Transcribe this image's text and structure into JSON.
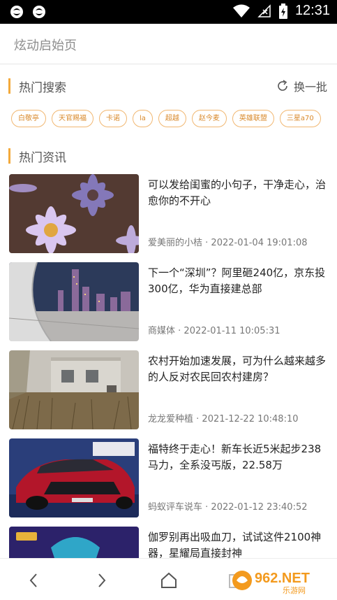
{
  "status_bar": {
    "time": "12:31"
  },
  "header": {
    "title": "炫动启始页"
  },
  "hot_search": {
    "title": "热门搜索",
    "refresh_label": "换一批",
    "tags": [
      "白敬亭",
      "天官赐福",
      "卡诺",
      "la",
      "超越",
      "赵今麦",
      "英雄联盟",
      "三星a70"
    ]
  },
  "hot_news": {
    "title": "热门资讯",
    "items": [
      {
        "title": "可以发给闺蜜的小句子，干净走心，治愈你的不开心",
        "source": "爱美丽的小桔",
        "time": "2022-01-04 19:01:08"
      },
      {
        "title": "下一个“深圳”？阿里砸240亿，京东投300亿，华为直接建总部",
        "source": "商媒体",
        "time": "2022-01-11 10:05:31"
      },
      {
        "title": "农村开始加速发展，可为什么越来越多的人反对农民回农村建房？",
        "source": "龙龙爱种植",
        "time": "2021-12-22 10:48:10"
      },
      {
        "title": "福特终于走心！新车长近5米起步238马力，全系没丐版，22.58万",
        "source": "蚂蚁评车说车",
        "time": "2022-01-12 23:40:52"
      },
      {
        "title": "伽罗别再出吸血刀，试试这件2100神器，星耀局直接封神",
        "source": "",
        "time": ""
      }
    ]
  },
  "watermark": {
    "text": "962.NET",
    "subtext": "乐游网"
  },
  "colors": {
    "accent": "#f3a93b",
    "tag_text": "#d98a2c",
    "tag_border": "#f1b771"
  }
}
